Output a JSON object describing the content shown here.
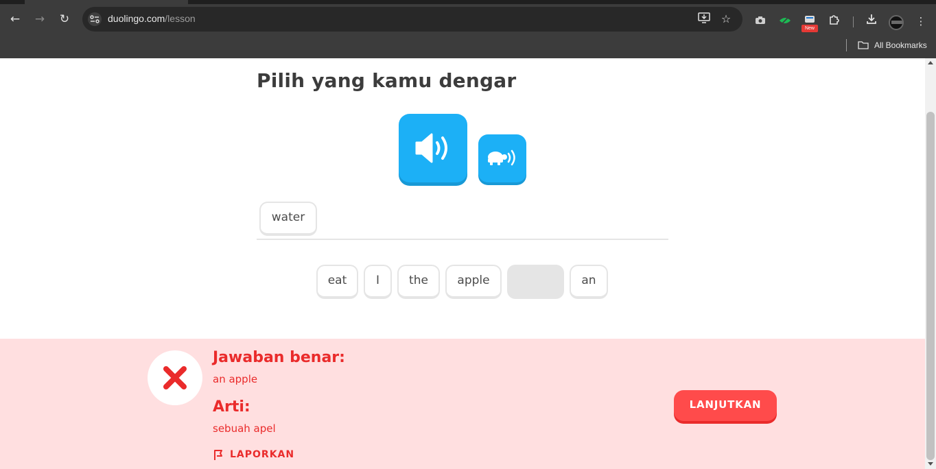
{
  "browser": {
    "url_domain": "duolingo.com",
    "url_path": "/lesson",
    "bookmarks_label": "All Bookmarks",
    "new_badge": "New"
  },
  "lesson": {
    "prompt_title": "Pilih yang kamu dengar",
    "answer_chips": [
      "water"
    ],
    "word_bank": [
      "eat",
      "I",
      "the",
      "apple",
      "",
      "an"
    ]
  },
  "feedback": {
    "correct_heading": "Jawaban benar:",
    "correct_answer": "an apple",
    "meaning_heading": "Arti:",
    "meaning_text": "sebuah apel",
    "report_label": "LAPORKAN",
    "continue_label": "LANJUTKAN"
  },
  "colors": {
    "accent_blue": "#1cb0f6",
    "error_red": "#ea2b2b",
    "feedback_bg": "#ffdfe0"
  }
}
